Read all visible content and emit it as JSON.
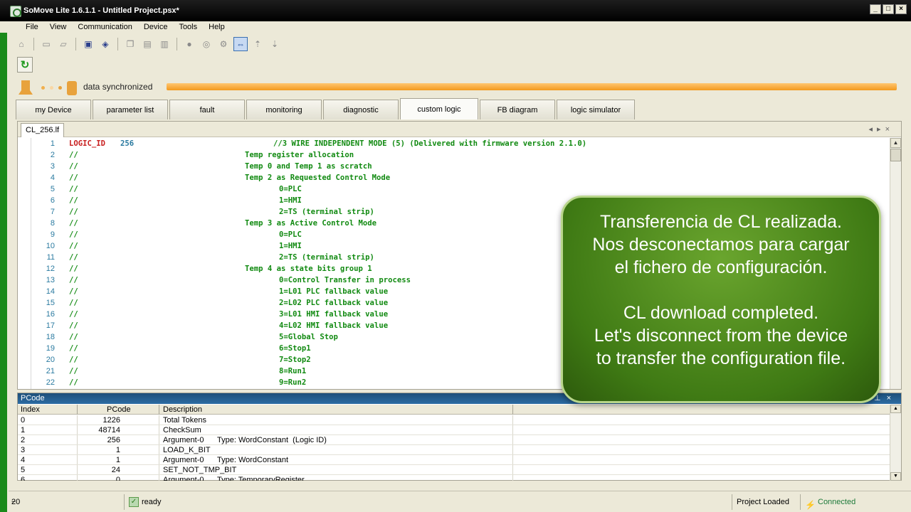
{
  "window": {
    "title": "SoMove Lite 1.6.1.1 - Untitled Project.psx*"
  },
  "menu": [
    "File",
    "View",
    "Communication",
    "Device",
    "Tools",
    "Help"
  ],
  "sync": {
    "status_text": "data synchronized"
  },
  "tabs": [
    "my Device",
    "parameter list",
    "fault",
    "monitoring",
    "diagnostic",
    "custom logic",
    "FB diagram",
    "logic simulator"
  ],
  "active_tab": "custom logic",
  "editor": {
    "file_tab": "CL_256.lf",
    "lines": [
      {
        "n": "1",
        "kw": "LOGIC_ID",
        "num": "256",
        "cm": "//3 WIRE INDEPENDENT MODE (5) (Delivered with firmware version 2.1.0)"
      },
      {
        "n": "2",
        "cm": "//",
        "text": "Temp register allocation"
      },
      {
        "n": "3",
        "cm": "//",
        "text": "Temp 0 and Temp 1 as scratch"
      },
      {
        "n": "4",
        "cm": "//",
        "text": "Temp 2 as Requested Control Mode"
      },
      {
        "n": "5",
        "cm": "//",
        "text": "0=PLC"
      },
      {
        "n": "6",
        "cm": "//",
        "text": "1=HMI"
      },
      {
        "n": "7",
        "cm": "//",
        "text": "2=TS (terminal strip)"
      },
      {
        "n": "8",
        "cm": "//",
        "text": "Temp 3 as Active Control Mode"
      },
      {
        "n": "9",
        "cm": "//",
        "text": "0=PLC"
      },
      {
        "n": "10",
        "cm": "//",
        "text": "1=HMI"
      },
      {
        "n": "11",
        "cm": "//",
        "text": "2=TS (terminal strip)"
      },
      {
        "n": "12",
        "cm": "//",
        "text": "Temp 4 as state bits group 1"
      },
      {
        "n": "13",
        "cm": "//",
        "text": "0=Control Transfer in process"
      },
      {
        "n": "14",
        "cm": "//",
        "text": "1=L01 PLC fallback value"
      },
      {
        "n": "15",
        "cm": "//",
        "text": "2=L02 PLC fallback value"
      },
      {
        "n": "16",
        "cm": "//",
        "text": "3=L01 HMI fallback value"
      },
      {
        "n": "17",
        "cm": "//",
        "text": "4=L02 HMI fallback value"
      },
      {
        "n": "18",
        "cm": "//",
        "text": "5=Global Stop"
      },
      {
        "n": "19",
        "cm": "//",
        "text": "6=Stop1"
      },
      {
        "n": "20",
        "cm": "//",
        "text": "7=Stop2"
      },
      {
        "n": "21",
        "cm": "//",
        "text": "8=Run1"
      },
      {
        "n": "22",
        "cm": "//",
        "text": "9=Run2"
      }
    ]
  },
  "pcode": {
    "title": "PCode",
    "columns": [
      "Index",
      "PCode",
      "Description"
    ],
    "rows": [
      {
        "index": "0",
        "pcode": "1226",
        "desc": "Total Tokens",
        "type": ""
      },
      {
        "index": "1",
        "pcode": "48714",
        "desc": "CheckSum",
        "type": ""
      },
      {
        "index": "2",
        "pcode": "256",
        "desc": "Argument-0",
        "type": "Type: WordConstant  (Logic ID)"
      },
      {
        "index": "3",
        "pcode": "1",
        "desc": "LOAD_K_BIT",
        "type": ""
      },
      {
        "index": "4",
        "pcode": "1",
        "desc": "Argument-0",
        "type": "Type: WordConstant"
      },
      {
        "index": "5",
        "pcode": "24",
        "desc": "SET_NOT_TMP_BIT",
        "type": ""
      },
      {
        "index": "6",
        "pcode": "0",
        "desc": "Argument-0",
        "type": "Type: TemporaryRegister"
      }
    ]
  },
  "statusbar": {
    "ready": "ready",
    "project": "Project Loaded",
    "connection": "Connected"
  },
  "overlay": {
    "es": [
      "Transferencia de CL realizada.",
      "Nos desconectamos para cargar",
      "el fichero de configuración."
    ],
    "en": [
      "CL download completed.",
      "Let's disconnect from the device",
      "to transfer the configuration file."
    ]
  }
}
